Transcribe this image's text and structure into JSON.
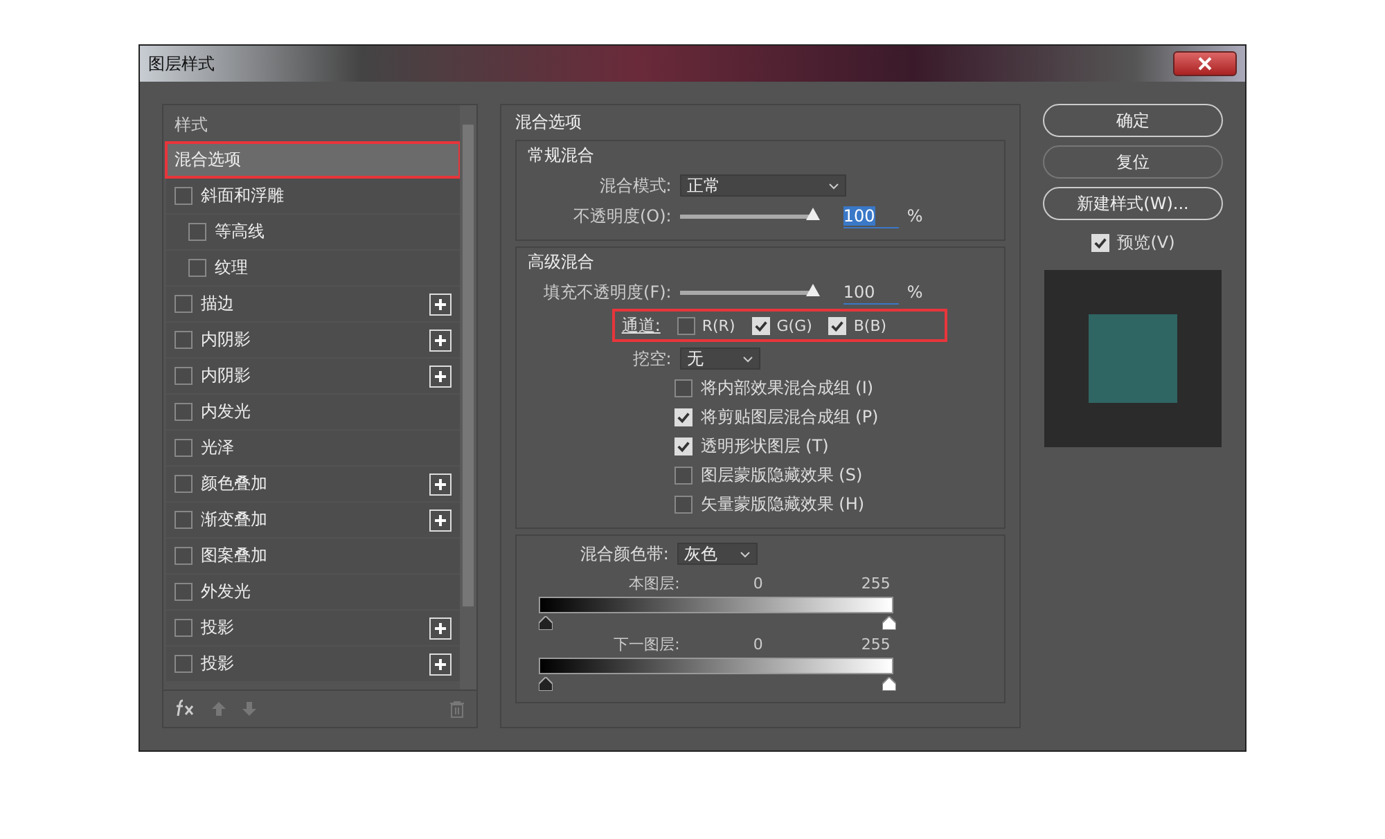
{
  "window": {
    "title": "图层样式"
  },
  "styles": {
    "heading": "样式",
    "items": [
      {
        "label": "混合选项",
        "kind": "plain",
        "selected": true,
        "addable": false
      },
      {
        "label": "斜面和浮雕",
        "kind": "check",
        "selected": false,
        "checked": false,
        "addable": false,
        "children": [
          {
            "label": "等高线",
            "kind": "check",
            "selected": false,
            "checked": false,
            "addable": false
          },
          {
            "label": "纹理",
            "kind": "check",
            "selected": false,
            "checked": false,
            "addable": false
          }
        ]
      },
      {
        "label": "描边",
        "kind": "check",
        "selected": false,
        "checked": false,
        "addable": true
      },
      {
        "label": "内阴影",
        "kind": "check",
        "selected": false,
        "checked": false,
        "addable": true
      },
      {
        "label": "内阴影",
        "kind": "check",
        "selected": false,
        "checked": false,
        "addable": true
      },
      {
        "label": "内发光",
        "kind": "check",
        "selected": false,
        "checked": false,
        "addable": false
      },
      {
        "label": "光泽",
        "kind": "check",
        "selected": false,
        "checked": false,
        "addable": false
      },
      {
        "label": "颜色叠加",
        "kind": "check",
        "selected": false,
        "checked": false,
        "addable": true
      },
      {
        "label": "渐变叠加",
        "kind": "check",
        "selected": false,
        "checked": false,
        "addable": true
      },
      {
        "label": "图案叠加",
        "kind": "check",
        "selected": false,
        "checked": false,
        "addable": false
      },
      {
        "label": "外发光",
        "kind": "check",
        "selected": false,
        "checked": false,
        "addable": false
      },
      {
        "label": "投影",
        "kind": "check",
        "selected": false,
        "checked": false,
        "addable": true
      },
      {
        "label": "投影",
        "kind": "check",
        "selected": false,
        "checked": false,
        "addable": true
      }
    ]
  },
  "blending": {
    "title": "混合选项",
    "general": {
      "title": "常规混合",
      "blend_mode": {
        "label": "混合模式:",
        "value": "正常"
      },
      "opacity": {
        "label": "不透明度(O):",
        "level": 1,
        "value": "100",
        "unit": "%"
      }
    },
    "advanced": {
      "title": "高级混合",
      "fill_opacity": {
        "label": "填充不透明度(F):",
        "level": 1,
        "value": "100",
        "unit": "%"
      },
      "channels": {
        "label": "通道:",
        "items": [
          {
            "label": "R(R)",
            "checked": false
          },
          {
            "label": "G(G)",
            "checked": true
          },
          {
            "label": "B(B)",
            "checked": true
          }
        ]
      },
      "knockout": {
        "label": "挖空:",
        "value": "无"
      },
      "options": [
        {
          "label": "将内部效果混合成组 (I)",
          "checked": false
        },
        {
          "label": "将剪贴图层混合成组 (P)",
          "checked": true
        },
        {
          "label": "透明形状图层 (T)",
          "checked": true
        },
        {
          "label": "图层蒙版隐藏效果 (S)",
          "checked": false
        },
        {
          "label": "矢量蒙版隐藏效果 (H)",
          "checked": false
        }
      ]
    },
    "blend_if": {
      "label": "混合颜色带:",
      "value": "灰色",
      "bars": [
        {
          "label": "本图层:",
          "low": "0",
          "high": "255"
        },
        {
          "label": "下一图层:",
          "low": "0",
          "high": "255"
        }
      ]
    }
  },
  "buttons": [
    "确定",
    "复位",
    "新建样式(W)..."
  ],
  "preview": {
    "label": "预览(V)",
    "checked": true
  }
}
